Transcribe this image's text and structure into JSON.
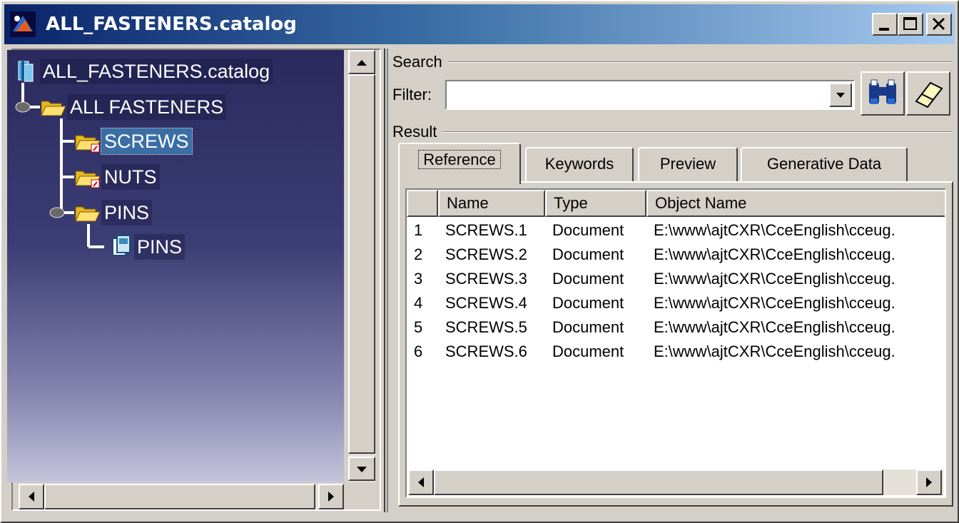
{
  "window": {
    "title": "ALL_FASTENERS.catalog"
  },
  "tree": {
    "root": "ALL_FASTENERS.catalog",
    "items": [
      {
        "label": "ALL FASTENERS"
      },
      {
        "label": "SCREWS",
        "selected": true
      },
      {
        "label": "NUTS"
      },
      {
        "label": "PINS"
      },
      {
        "label": "PINS"
      }
    ]
  },
  "search": {
    "group_label": "Search",
    "filter_label": "Filter:",
    "filter_value": ""
  },
  "result": {
    "group_label": "Result",
    "tabs": [
      "Reference",
      "Keywords",
      "Preview",
      "Generative Data"
    ],
    "active_tab": "Reference",
    "columns": [
      "Name",
      "Type",
      "Object Name"
    ],
    "rows": [
      {
        "num": "1",
        "name": "SCREWS.1",
        "type": "Document",
        "object": "E:\\www\\ajtCXR\\CceEnglish\\cceug."
      },
      {
        "num": "2",
        "name": "SCREWS.2",
        "type": "Document",
        "object": "E:\\www\\ajtCXR\\CceEnglish\\cceug."
      },
      {
        "num": "3",
        "name": "SCREWS.3",
        "type": "Document",
        "object": "E:\\www\\ajtCXR\\CceEnglish\\cceug."
      },
      {
        "num": "4",
        "name": "SCREWS.4",
        "type": "Document",
        "object": "E:\\www\\ajtCXR\\CceEnglish\\cceug."
      },
      {
        "num": "5",
        "name": "SCREWS.5",
        "type": "Document",
        "object": "E:\\www\\ajtCXR\\CceEnglish\\cceug."
      },
      {
        "num": "6",
        "name": "SCREWS.6",
        "type": "Document",
        "object": "E:\\www\\ajtCXR\\CceEnglish\\cceug."
      }
    ]
  },
  "icons": {
    "app": "catalog-app-icon",
    "minimize": "minimize-icon",
    "maximize": "maximize-icon",
    "close": "close-icon",
    "search": "binoculars-icon",
    "clear": "eraser-icon"
  },
  "colors": {
    "titlebar_start": "#0a246a",
    "titlebar_end": "#a6caf0",
    "tree_background": "#3b3d75",
    "selection": "#3a6ea5"
  }
}
